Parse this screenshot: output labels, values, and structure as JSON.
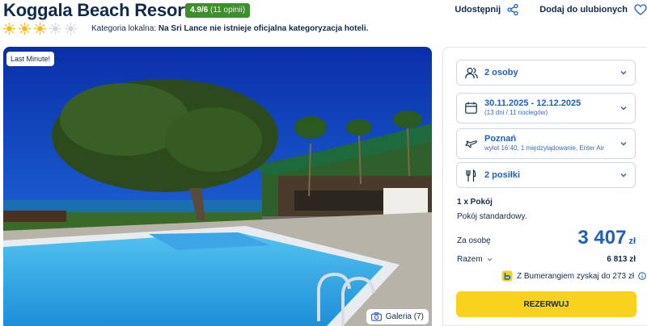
{
  "hotel": {
    "name": "Koggala Beach Resort",
    "rating": "4.9/6",
    "reviews": "(11 opinii)",
    "suns_filled": 3,
    "suns_total": 5,
    "category_label": "Kategoria lokalna:",
    "category_value": "Na Sri Lance nie istnieje oficjalna kategoryzacja hoteli."
  },
  "actions": {
    "share": "Udostępnij",
    "favorite": "Dodaj do ulubionych"
  },
  "photo": {
    "badge": "Last Minute!",
    "gallery": "Galeria (7)"
  },
  "booking": {
    "persons": "2 osoby",
    "dates": "30.11.2025 - 12.12.2025",
    "dates_sub": "(13 dni / 11 noclegów)",
    "departure": "Poznań",
    "departure_sub": "wylot 16:40, 1 międzylądowanie, Enter Air",
    "meals": "2 posiłki",
    "room_count": "1 x Pokój",
    "room_type": "Pokój standardowy.",
    "per_person_label": "Za osobę",
    "per_person_price": "3 407",
    "currency": "zł",
    "total_label": "Razem",
    "total_value": "6 813 zł",
    "bumerang": "Z Bumerangiem zyskaj do 273 zł",
    "reserve": "REZERWUJ"
  },
  "colors": {
    "brand_blue": "#1f5fbf",
    "navy": "#102a4c",
    "rating_green": "#3d8f2e",
    "cta_yellow": "#f8d21c",
    "sun": "#f5b81c"
  },
  "icons": {
    "share": "share-icon",
    "favorite": "heart-icon",
    "persons": "users-icon",
    "dates": "calendar-icon",
    "departure": "plane-icon",
    "meals": "cutlery-icon",
    "gallery": "camera-icon",
    "info": "info-icon"
  }
}
